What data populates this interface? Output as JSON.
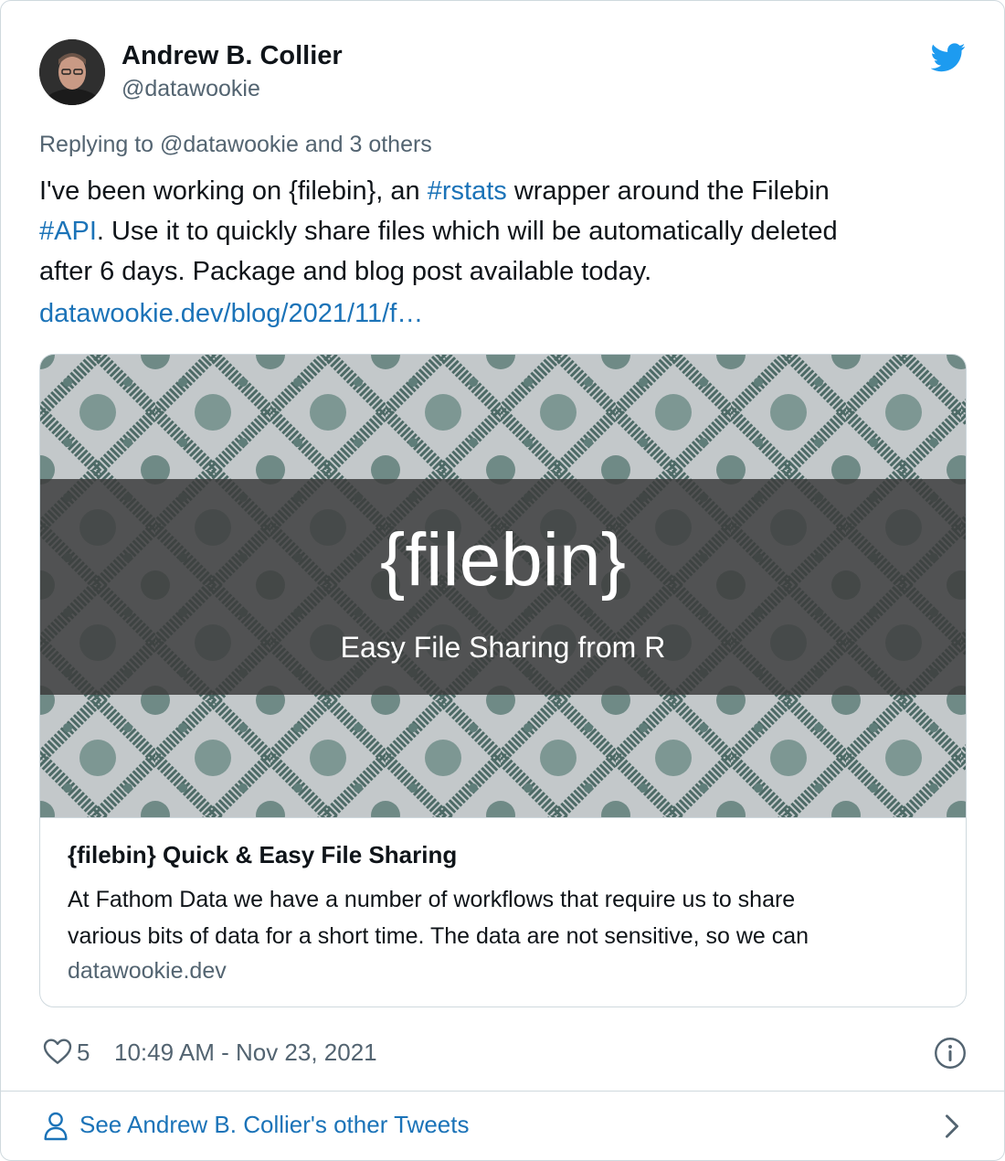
{
  "author": {
    "name": "Andrew B. Collier",
    "handle": "@datawookie"
  },
  "reply_context": "Replying to @datawookie and 3 others",
  "tweet": {
    "line1_a": "I've been working on {filebin}, an ",
    "hashtag1": "#rstats",
    "line1_b": " wrapper around the Filebin",
    "hashtag2": "#API",
    "line2_b": ". Use it to quickly share files which will be automatically deleted",
    "line3": "after 6 days. Package and blog post available today.",
    "url": "datawookie.dev/blog/2021/11/f…"
  },
  "link_card": {
    "image_title": "{filebin}",
    "image_subtitle": "Easy File Sharing from R",
    "title": "{filebin} Quick & Easy File Sharing",
    "description_line1": "At Fathom Data we have a number of workflows that require us to share",
    "description_line2": "various bits of data for a short time. The data are not sensitive, so we can",
    "domain": "datawookie.dev"
  },
  "footer": {
    "likes": "5",
    "timestamp": "10:49 AM - Nov 23, 2021"
  },
  "see_more": "See Andrew B. Collier's other Tweets",
  "icons": [
    "twitter-bird-icon",
    "heart-icon",
    "info-icon",
    "user-icon",
    "chevron-right-icon"
  ],
  "colors": {
    "link": "#1b73b8",
    "twitter_blue": "#1d9bf0",
    "text": "#0f1419",
    "muted": "#536471",
    "border": "#cfd9de"
  }
}
